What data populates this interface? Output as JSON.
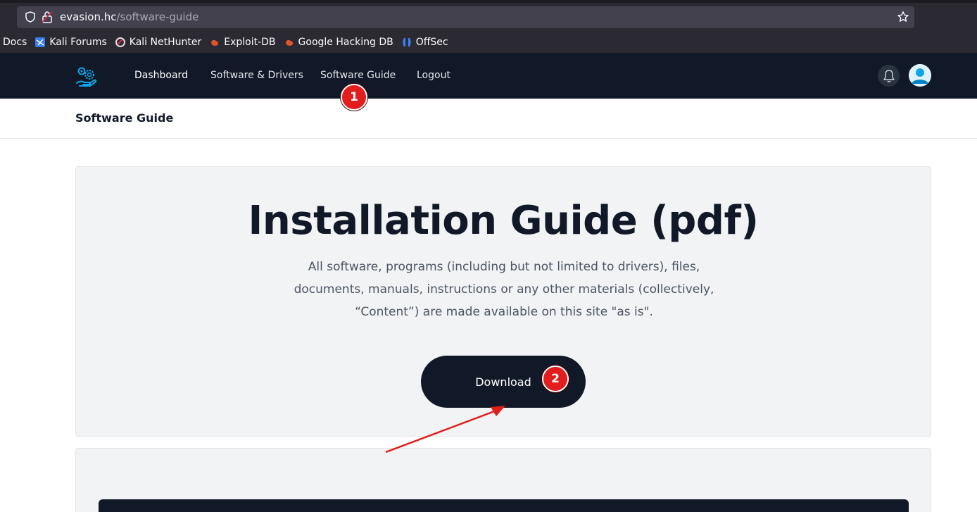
{
  "browser": {
    "url_host": "evasion.hc",
    "url_path": "/software-guide",
    "bookmarks": [
      {
        "label": "Docs",
        "icon": "none"
      },
      {
        "label": "Kali Forums",
        "icon": "kali-forums-icon"
      },
      {
        "label": "Kali NetHunter",
        "icon": "nethunter-icon"
      },
      {
        "label": "Exploit-DB",
        "icon": "exploit-db-icon"
      },
      {
        "label": "Google Hacking DB",
        "icon": "ghdb-icon"
      },
      {
        "label": "OffSec",
        "icon": "offsec-icon"
      }
    ]
  },
  "nav": {
    "links": [
      {
        "label": "Dashboard"
      },
      {
        "label": "Software & Drivers"
      },
      {
        "label": "Software Guide"
      },
      {
        "label": "Logout"
      }
    ]
  },
  "page": {
    "title": "Software Guide"
  },
  "card": {
    "heading": "Installation Guide (pdf)",
    "description": "All software, programs (including but not limited to drivers), files, documents, manuals, instructions or any other materials (collectively, “Content”) are made available on this site \"as is\".",
    "download_label": "Download"
  },
  "annotations": {
    "marker_1": "1",
    "marker_2": "2",
    "marker_color": "#e11d1d",
    "arrow_color": "#e11d1d"
  },
  "colors": {
    "nav_bg": "#111827",
    "card_bg": "#f2f3f5",
    "accent_blue": "#0ea5e9"
  }
}
